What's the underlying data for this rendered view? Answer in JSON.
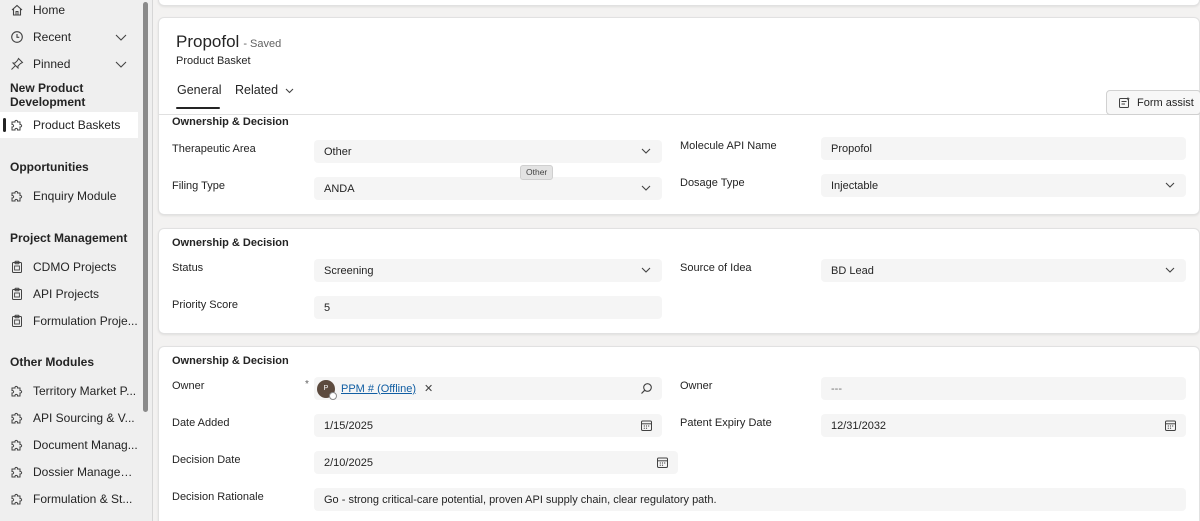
{
  "sidebar": {
    "items_top": [
      {
        "label": "Home",
        "icon": "home-icon"
      },
      {
        "label": "Recent",
        "icon": "clock-icon"
      },
      {
        "label": "Pinned",
        "icon": "pin-icon"
      }
    ],
    "groups": {
      "npd": "New Product Development",
      "opportunities": "Opportunities",
      "project_management": "Project Management",
      "other_modules": "Other Modules"
    },
    "npd_items": [
      {
        "label": "Product Baskets"
      }
    ],
    "opp_items": [
      {
        "label": "Enquiry Module"
      }
    ],
    "pm_items": [
      {
        "label": "CDMO Projects"
      },
      {
        "label": "API Projects"
      },
      {
        "label": "Formulation Proje..."
      }
    ],
    "other_items": [
      {
        "label": "Territory Market P..."
      },
      {
        "label": "API Sourcing & V..."
      },
      {
        "label": "Document Manag..."
      },
      {
        "label": "Dossier Managem..."
      },
      {
        "label": "Formulation & St..."
      }
    ]
  },
  "header": {
    "title": "Propofol",
    "saved": "- Saved",
    "entity": "Product Basket"
  },
  "tabs": [
    {
      "label": "General"
    },
    {
      "label": "Related"
    }
  ],
  "form_assist": "Form assist",
  "sections": [
    {
      "title": "Ownership & Decision",
      "fields": {
        "therapeutic_area": {
          "label": "Therapeutic Area",
          "value": "Other"
        },
        "filing_type": {
          "label": "Filing Type",
          "value": "ANDA"
        },
        "molecule_api_name": {
          "label": "Molecule API Name",
          "value": "Propofol"
        },
        "dosage_type": {
          "label": "Dosage Type",
          "value": "Injectable"
        }
      },
      "tooltip": "Other"
    },
    {
      "title": "Ownership & Decision",
      "fields": {
        "status": {
          "label": "Status",
          "value": "Screening"
        },
        "priority_score": {
          "label": "Priority Score",
          "value": "5"
        },
        "source_of_idea": {
          "label": "Source of Idea",
          "value": "BD Lead"
        }
      }
    },
    {
      "title": "Ownership & Decision",
      "fields": {
        "owner": {
          "label": "Owner",
          "required": "*",
          "avatar_initial": "P",
          "value": "PPM # (Offline)",
          "remove": "✕"
        },
        "owner2": {
          "label": "Owner",
          "value": "---"
        },
        "date_added": {
          "label": "Date Added",
          "value": "1/15/2025"
        },
        "patent_expiry": {
          "label": "Patent Expiry Date",
          "value": "12/31/2032"
        },
        "decision_date": {
          "label": "Decision Date",
          "value": "2/10/2025"
        },
        "decision_rationale": {
          "label": "Decision Rationale",
          "value": "Go - strong critical-care potential, proven API supply chain, clear regulatory path."
        }
      }
    }
  ],
  "colors": {
    "link": "#115ea3",
    "field_bg": "#f5f5f5",
    "sidebar_bg": "#efefef"
  }
}
